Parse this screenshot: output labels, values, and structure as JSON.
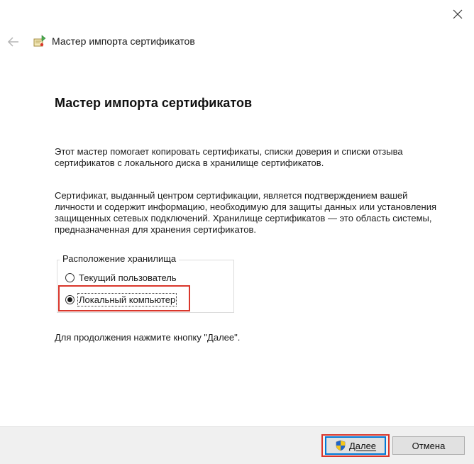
{
  "window": {
    "title": "Мастер импорта сертификатов",
    "close_icon": "close-icon",
    "back_icon": "back-arrow-icon",
    "wizard_icon": "certificate-wizard-icon"
  },
  "main": {
    "heading": "Мастер импорта сертификатов",
    "intro": "Этот мастер помогает копировать сертификаты, списки доверия и списки отзыва сертификатов с локального диска в хранилище сертификатов.",
    "description": "Сертификат, выданный центром сертификации, является подтверждением вашей личности и содержит информацию, необходимую для защиты данных или установления защищенных сетевых подключений. Хранилище сертификатов — это область системы, предназначенная для хранения сертификатов.",
    "store_location": {
      "label": "Расположение хранилища",
      "options": [
        {
          "label": "Текущий пользователь",
          "checked": false
        },
        {
          "label": "Локальный компьютер",
          "checked": true
        }
      ]
    },
    "hint": "Для продолжения нажмите кнопку \"Далее\"."
  },
  "footer": {
    "next_label": "Далее",
    "cancel_label": "Отмена",
    "next_icon": "uac-shield-icon"
  },
  "colors": {
    "highlight": "#d9362b",
    "focus_border": "#0078d7",
    "footer_bg": "#f0f0f0"
  }
}
